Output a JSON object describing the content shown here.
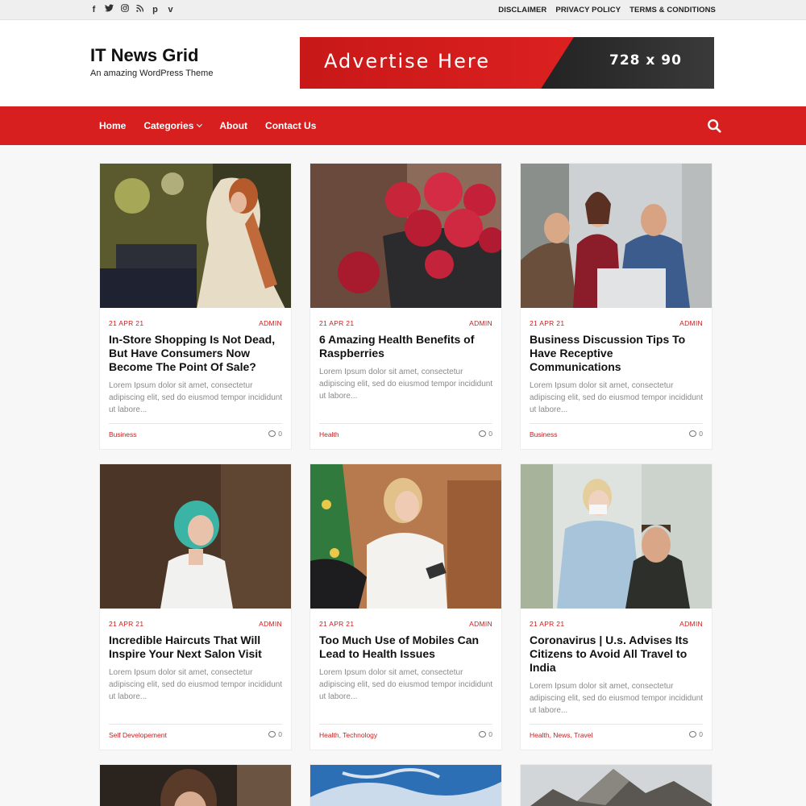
{
  "topbar": {
    "social": [
      {
        "icon": "facebook-icon",
        "glyph": "f"
      },
      {
        "icon": "twitter-icon",
        "glyph": "t"
      },
      {
        "icon": "instagram-icon",
        "glyph": "◎"
      },
      {
        "icon": "rss-icon",
        "glyph": "⊿"
      },
      {
        "icon": "pinterest-icon",
        "glyph": "p"
      },
      {
        "icon": "vimeo-icon",
        "glyph": "v"
      }
    ],
    "links": [
      "DISCLAIMER",
      "PRIVACY POLICY",
      "TERMS & CONDITIONS"
    ]
  },
  "header": {
    "title": "IT News Grid",
    "tagline": "An amazing WordPress Theme",
    "ad_text": "Advertise Here",
    "ad_size": "728 x 90"
  },
  "nav": {
    "items": [
      "Home",
      "Categories",
      "About",
      "Contact Us"
    ],
    "search_icon": "search-icon"
  },
  "colors": {
    "accent": "#d71f1f",
    "meta": "#c81e1e"
  },
  "posts": [
    {
      "date": "21 APR 21",
      "author": "ADMIN",
      "title": "In-Store Shopping Is Not Dead, But Have Consumers Now Become The Point Of Sale?",
      "excerpt": "Lorem Ipsum dolor sit amet, consectetur adipiscing elit, sed do eiusmod tempor incididunt ut labore...",
      "categories": "Business",
      "comments": "0"
    },
    {
      "date": "21 APR 21",
      "author": "ADMIN",
      "title": "6 Amazing Health Benefits of Raspberries",
      "excerpt": "Lorem Ipsum dolor sit amet, consectetur adipiscing elit, sed do eiusmod tempor incididunt ut labore...",
      "categories": "Health",
      "comments": "0"
    },
    {
      "date": "21 APR 21",
      "author": "ADMIN",
      "title": "Business Discussion Tips To Have Receptive Communications",
      "excerpt": "Lorem Ipsum dolor sit amet, consectetur adipiscing elit, sed do eiusmod tempor incididunt ut labore...",
      "categories": "Business",
      "comments": "0"
    },
    {
      "date": "21 APR 21",
      "author": "ADMIN",
      "title": "Incredible Haircuts That Will Inspire Your Next Salon Visit",
      "excerpt": "Lorem Ipsum dolor sit amet, consectetur adipiscing elit, sed do eiusmod tempor incididunt ut labore...",
      "categories": "Self Developement",
      "comments": "0"
    },
    {
      "date": "21 APR 21",
      "author": "ADMIN",
      "title": "Too Much Use of Mobiles Can Lead to Health Issues",
      "excerpt": "Lorem Ipsum dolor sit amet, consectetur adipiscing elit, sed do eiusmod tempor incididunt ut labore...",
      "categories": "Health, Technology",
      "comments": "0"
    },
    {
      "date": "21 APR 21",
      "author": "ADMIN",
      "title": "Coronavirus | U.s. Advises Its Citizens to Avoid All Travel to India",
      "excerpt": "Lorem Ipsum dolor sit amet, consectetur adipiscing elit, sed do eiusmod tempor incididunt ut labore...",
      "categories": "Health, News, Travel",
      "comments": "0"
    }
  ]
}
